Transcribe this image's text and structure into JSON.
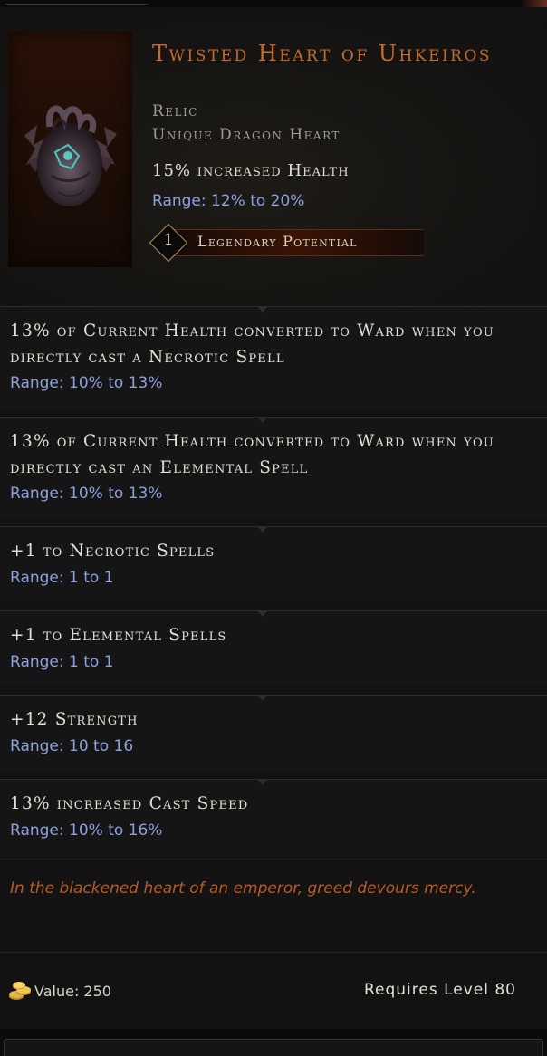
{
  "item": {
    "name": "Twisted Heart of Uhkeiros",
    "rarity": "Relic",
    "base_type": "Unique Dragon Heart",
    "implicit": {
      "text": "15% increased Health",
      "range": "Range: 12% to 20%"
    },
    "legendary_potential": {
      "count": "1",
      "label": "Legendary Potential"
    }
  },
  "affixes": [
    {
      "text": "13% of Current Health converted to Ward when you directly cast a Necrotic Spell",
      "range": "Range: 10% to 13%"
    },
    {
      "text": "13% of Current Health converted to Ward when you directly cast an Elemental Spell",
      "range": "Range: 10% to 13%"
    },
    {
      "text": "+1 to Necrotic Spells",
      "range": "Range: 1 to 1"
    },
    {
      "text": "+1 to Elemental Spells",
      "range": "Range: 1 to 1"
    },
    {
      "text": "+12 Strength",
      "range": "Range: 10 to 16"
    },
    {
      "text": "13% increased Cast Speed",
      "range": "Range: 10% to 16%"
    }
  ],
  "lore": "In the blackened heart of an emperor, greed devours mercy.",
  "footer": {
    "value": "Value: 250",
    "requirement": "Requires Level 80",
    "coin_icon": "gold-coins-icon"
  },
  "colors": {
    "title": "#c9692e",
    "range": "#8ea0dd",
    "lore": "#b85a2a",
    "text": "#e4dfd4"
  }
}
